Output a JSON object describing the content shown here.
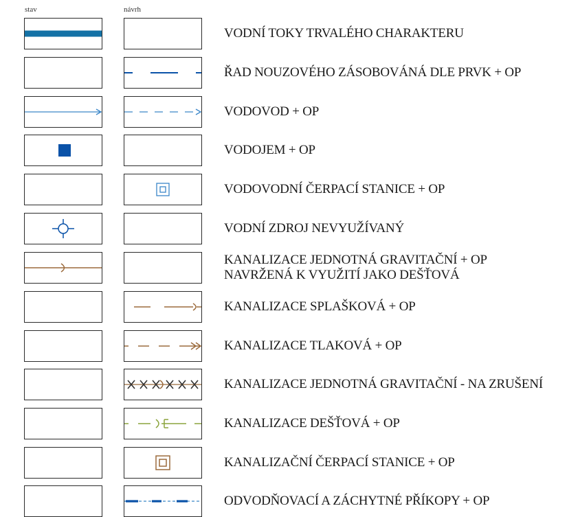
{
  "headers": {
    "stav": "stav",
    "navrh": "návrh"
  },
  "colors": {
    "blue": "#0a52a8",
    "lightblue": "#3a86c8",
    "teal": "#1472a6",
    "brown": "#9b6a3c",
    "green": "#8aa33c",
    "dark": "#333333"
  },
  "rows": [
    {
      "label": "VODNÍ TOKY TRVALÉHO CHARAKTERU"
    },
    {
      "label": "ŘAD NOUZOVÉHO ZÁSOBOVÁNÁ DLE PRVK + OP"
    },
    {
      "label": "VODOVOD + OP"
    },
    {
      "label": "VODOJEM + OP"
    },
    {
      "label": "VODOVODNÍ ČERPACÍ STANICE + OP"
    },
    {
      "label": "VODNÍ ZDROJ NEVYUŽÍVANÝ"
    },
    {
      "label": "KANALIZACE JEDNOTNÁ GRAVITAČNÍ + OP",
      "label2": "NAVRŽENÁ K VYUŽITÍ JAKO DEŠŤOVÁ"
    },
    {
      "label": "KANALIZACE SPLAŠKOVÁ + OP"
    },
    {
      "label": "KANALIZACE TLAKOVÁ + OP"
    },
    {
      "label": "KANALIZACE JEDNOTNÁ GRAVITAČNÍ - NA ZRUŠENÍ"
    },
    {
      "label": "KANALIZACE DEŠŤOVÁ + OP"
    },
    {
      "label": "KANALIZAČNÍ ČERPACÍ STANICE + OP"
    },
    {
      "label": "ODVODŇOVACÍ A ZÁCHYTNÉ PŘÍKOPY + OP"
    }
  ]
}
